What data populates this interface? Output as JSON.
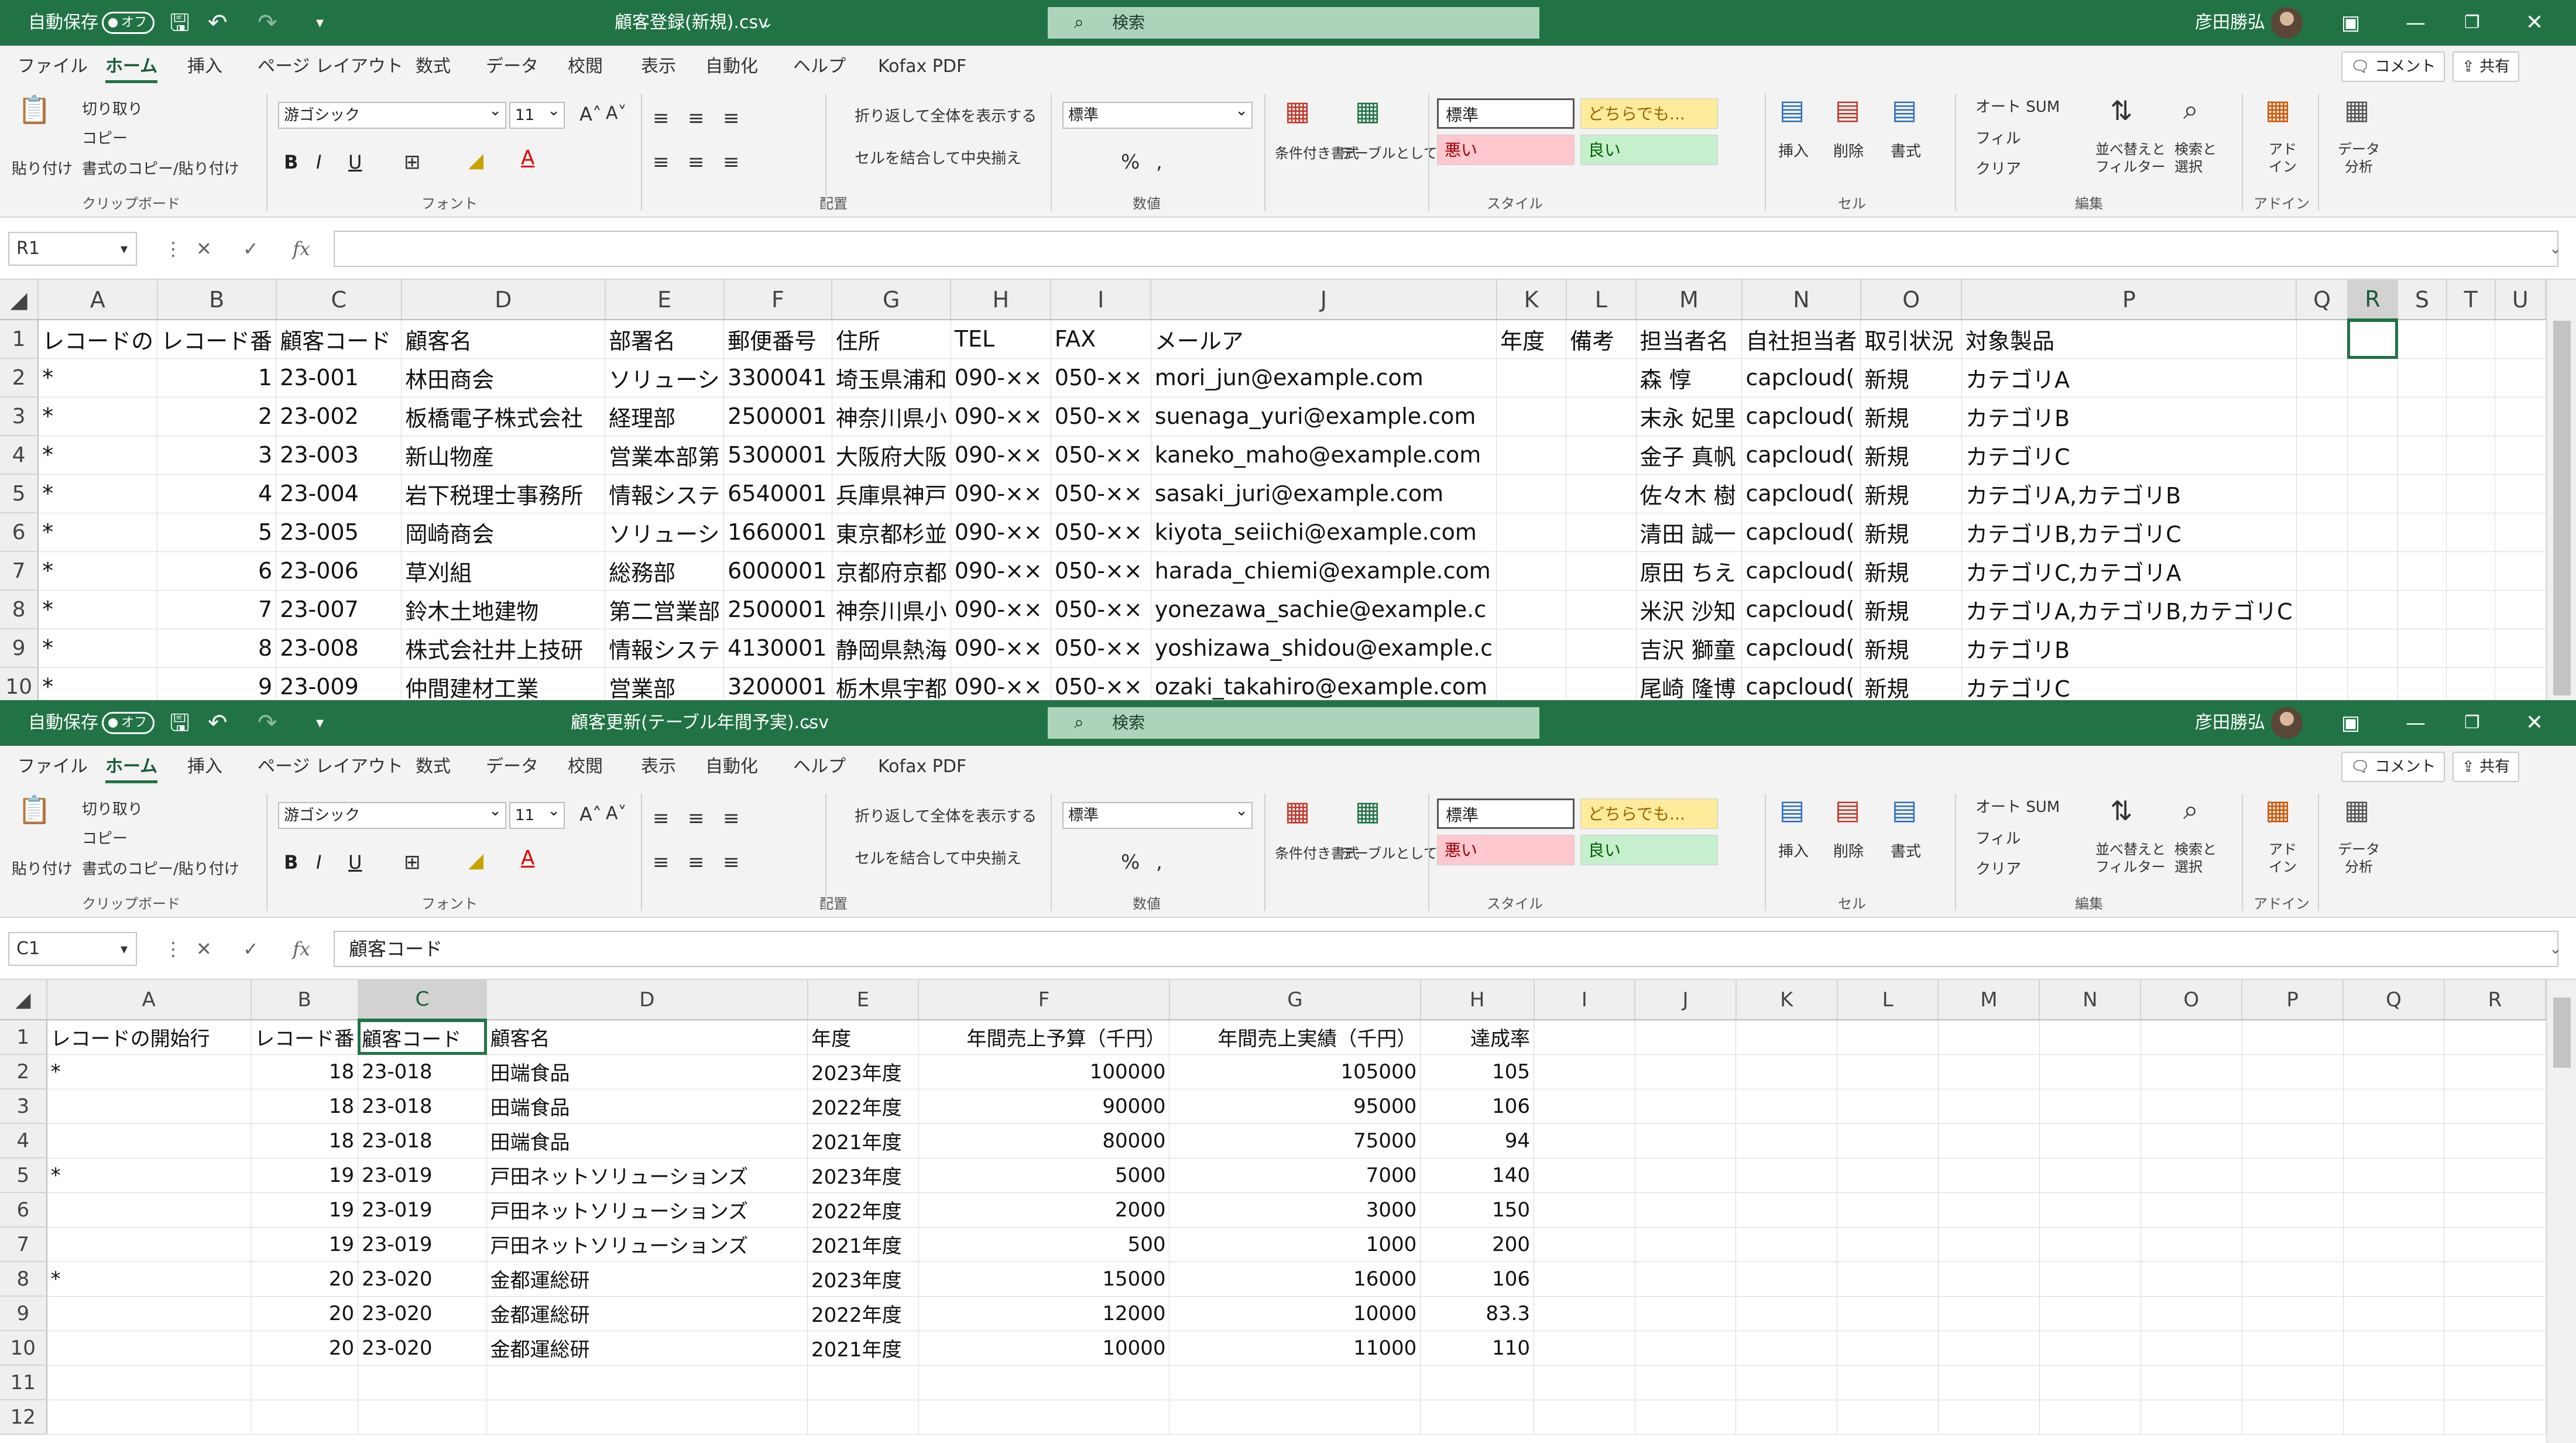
{
  "common": {
    "autosave_label": "自動保存",
    "autosave_state": "オフ",
    "search_label": "検索",
    "user_name": "彦田勝弘",
    "menu_tabs": [
      "ファイル",
      "ホーム",
      "挿入",
      "ページ レイアウト",
      "数式",
      "データ",
      "校閲",
      "表示",
      "自動化",
      "ヘルプ",
      "Kofax PDF"
    ],
    "comment_label": "コメント",
    "share_label": "共有",
    "ribbon": {
      "paste": "貼り付け",
      "cut": "切り取り",
      "copy": "コピー",
      "format_painter": "書式のコピー/貼り付け",
      "clipboard": "クリップボード",
      "font_name": "游ゴシック",
      "font_size": "11",
      "font": "フォント",
      "wrap_text": "折り返して全体を表示する",
      "merge_center": "セルを結合して中央揃え",
      "alignment": "配置",
      "number_format": "標準",
      "number": "数値",
      "conditional_format": "条件付き書式",
      "format_as_table": "テーブルとして書式設定",
      "style_normal": "標準",
      "style_neutral": "どちらでも...",
      "style_bad": "悪い",
      "style_good": "良い",
      "styles": "スタイル",
      "insert": "挿入",
      "delete": "削除",
      "format": "書式",
      "cells": "セル",
      "autosum": "オート SUM",
      "fill": "フィル",
      "clear": "クリア",
      "sort_filter": "並べ替えと フィルター",
      "find_select": "検索と 選択",
      "editing": "編集",
      "addin": "アド イン",
      "addin_group": "アドイン",
      "data_analysis": "データ 分析"
    },
    "colors": {
      "accent": "#217346",
      "style_bad_bg": "#ffc7ce",
      "style_good_bg": "#c6efce",
      "style_neutral_bg": "#ffeb9c"
    }
  },
  "window1": {
    "title": "顧客登録(新規).csv",
    "name_box": "R1",
    "formula_text": "",
    "columns": [
      "A",
      "B",
      "C",
      "D",
      "E",
      "F",
      "G",
      "H",
      "I",
      "J",
      "K",
      "L",
      "M",
      "N",
      "O",
      "P",
      "Q",
      "R",
      "S",
      "T",
      "U"
    ],
    "selected_col": "R",
    "rows": [
      {
        "n": "1",
        "cells": [
          "レコードの",
          "レコード番",
          "顧客コード",
          "顧客名",
          "部署名",
          "郵便番号",
          "住所",
          "TEL",
          "FAX",
          "メールア",
          "年度",
          "備考",
          "担当者名",
          "自社担当者",
          "取引状況",
          "対象製品",
          "",
          "",
          "",
          "",
          ""
        ]
      },
      {
        "n": "2",
        "cells": [
          "*",
          "1",
          "23-001",
          "林田商会",
          "ソリューシ",
          "3300041",
          "埼玉県浦和",
          "090-××",
          "050-××",
          "mori_jun@example.com",
          "",
          "",
          "森 惇",
          "capcloud(",
          "新規",
          "カテゴリA",
          "",
          "",
          "",
          "",
          ""
        ]
      },
      {
        "n": "3",
        "cells": [
          "*",
          "2",
          "23-002",
          "板橋電子株式会社",
          "経理部",
          "2500001",
          "神奈川県小",
          "090-××",
          "050-××",
          "suenaga_yuri@example.com",
          "",
          "",
          "末永 妃里",
          "capcloud(",
          "新規",
          "カテゴリB",
          "",
          "",
          "",
          "",
          ""
        ]
      },
      {
        "n": "4",
        "cells": [
          "*",
          "3",
          "23-003",
          "新山物産",
          "営業本部第",
          "5300001",
          "大阪府大阪",
          "090-××",
          "050-××",
          "kaneko_maho@example.com",
          "",
          "",
          "金子 真帆",
          "capcloud(",
          "新規",
          "カテゴリC",
          "",
          "",
          "",
          "",
          ""
        ]
      },
      {
        "n": "5",
        "cells": [
          "*",
          "4",
          "23-004",
          "岩下税理士事務所",
          "情報システ",
          "6540001",
          "兵庫県神戸",
          "090-××",
          "050-××",
          "sasaki_juri@example.com",
          "",
          "",
          "佐々木 樹",
          "capcloud(",
          "新規",
          "カテゴリA,カテゴリB",
          "",
          "",
          "",
          "",
          ""
        ]
      },
      {
        "n": "6",
        "cells": [
          "*",
          "5",
          "23-005",
          "岡崎商会",
          "ソリューシ",
          "1660001",
          "東京都杉並",
          "090-××",
          "050-××",
          "kiyota_seiichi@example.com",
          "",
          "",
          "清田 誠一",
          "capcloud(",
          "新規",
          "カテゴリB,カテゴリC",
          "",
          "",
          "",
          "",
          ""
        ]
      },
      {
        "n": "7",
        "cells": [
          "*",
          "6",
          "23-006",
          "草刈組",
          "総務部",
          "6000001",
          "京都府京都",
          "090-××",
          "050-××",
          "harada_chiemi@example.com",
          "",
          "",
          "原田 ちえ",
          "capcloud(",
          "新規",
          "カテゴリC,カテゴリA",
          "",
          "",
          "",
          "",
          ""
        ]
      },
      {
        "n": "8",
        "cells": [
          "*",
          "7",
          "23-007",
          "鈴木土地建物",
          "第二営業部",
          "2500001",
          "神奈川県小",
          "090-××",
          "050-××",
          "yonezawa_sachie@example.c",
          "",
          "",
          "米沢 沙知",
          "capcloud(",
          "新規",
          "カテゴリA,カテゴリB,カテゴリC",
          "",
          "",
          "",
          "",
          ""
        ]
      },
      {
        "n": "9",
        "cells": [
          "*",
          "8",
          "23-008",
          "株式会社井上技研",
          "情報システ",
          "4130001",
          "静岡県熱海",
          "090-××",
          "050-××",
          "yoshizawa_shidou@example.c",
          "",
          "",
          "吉沢 獅童",
          "capcloud(",
          "新規",
          "カテゴリB",
          "",
          "",
          "",
          "",
          ""
        ]
      },
      {
        "n": "10",
        "cells": [
          "*",
          "9",
          "23-009",
          "仲間建材工業",
          "営業部",
          "3200001",
          "栃木県宇都",
          "090-××",
          "050-××",
          "ozaki_takahiro@example.com",
          "",
          "",
          "尾崎 隆博",
          "capcloud(",
          "新規",
          "カテゴリC",
          "",
          "",
          "",
          "",
          ""
        ]
      }
    ]
  },
  "window2": {
    "title": "顧客更新(テーブル年間予実).csv",
    "name_box": "C1",
    "formula_text": "顧客コード",
    "columns": [
      "A",
      "B",
      "C",
      "D",
      "E",
      "F",
      "G",
      "H",
      "I",
      "J",
      "K",
      "L",
      "M",
      "N",
      "O",
      "P",
      "Q",
      "R"
    ],
    "selected_col": "C",
    "rows": [
      {
        "n": "1",
        "cells": [
          "レコードの開始行",
          "レコード番",
          "顧客コード",
          "顧客名",
          "年度",
          "年間売上予算（千円）",
          "年間売上実績（千円）",
          "達成率",
          "",
          "",
          "",
          "",
          "",
          "",
          "",
          "",
          "",
          ""
        ]
      },
      {
        "n": "2",
        "cells": [
          "*",
          "18",
          "23-018",
          "田端食品",
          "2023年度",
          "100000",
          "105000",
          "105",
          "",
          "",
          "",
          "",
          "",
          "",
          "",
          "",
          "",
          ""
        ]
      },
      {
        "n": "3",
        "cells": [
          "",
          "18",
          "23-018",
          "田端食品",
          "2022年度",
          "90000",
          "95000",
          "106",
          "",
          "",
          "",
          "",
          "",
          "",
          "",
          "",
          "",
          ""
        ]
      },
      {
        "n": "4",
        "cells": [
          "",
          "18",
          "23-018",
          "田端食品",
          "2021年度",
          "80000",
          "75000",
          "94",
          "",
          "",
          "",
          "",
          "",
          "",
          "",
          "",
          "",
          ""
        ]
      },
      {
        "n": "5",
        "cells": [
          "*",
          "19",
          "23-019",
          "戸田ネットソリューションズ",
          "2023年度",
          "5000",
          "7000",
          "140",
          "",
          "",
          "",
          "",
          "",
          "",
          "",
          "",
          "",
          ""
        ]
      },
      {
        "n": "6",
        "cells": [
          "",
          "19",
          "23-019",
          "戸田ネットソリューションズ",
          "2022年度",
          "2000",
          "3000",
          "150",
          "",
          "",
          "",
          "",
          "",
          "",
          "",
          "",
          "",
          ""
        ]
      },
      {
        "n": "7",
        "cells": [
          "",
          "19",
          "23-019",
          "戸田ネットソリューションズ",
          "2021年度",
          "500",
          "1000",
          "200",
          "",
          "",
          "",
          "",
          "",
          "",
          "",
          "",
          "",
          ""
        ]
      },
      {
        "n": "8",
        "cells": [
          "*",
          "20",
          "23-020",
          "金都運総研",
          "2023年度",
          "15000",
          "16000",
          "106",
          "",
          "",
          "",
          "",
          "",
          "",
          "",
          "",
          "",
          ""
        ]
      },
      {
        "n": "9",
        "cells": [
          "",
          "20",
          "23-020",
          "金都運総研",
          "2022年度",
          "12000",
          "10000",
          "83.3",
          "",
          "",
          "",
          "",
          "",
          "",
          "",
          "",
          "",
          ""
        ]
      },
      {
        "n": "10",
        "cells": [
          "",
          "20",
          "23-020",
          "金都運総研",
          "2021年度",
          "10000",
          "11000",
          "110",
          "",
          "",
          "",
          "",
          "",
          "",
          "",
          "",
          "",
          ""
        ]
      },
      {
        "n": "11",
        "cells": [
          "",
          "",
          "",
          "",
          "",
          "",
          "",
          "",
          "",
          "",
          "",
          "",
          "",
          "",
          "",
          "",
          "",
          ""
        ]
      },
      {
        "n": "12",
        "cells": [
          "",
          "",
          "",
          "",
          "",
          "",
          "",
          "",
          "",
          "",
          "",
          "",
          "",
          "",
          "",
          "",
          "",
          ""
        ]
      }
    ]
  }
}
